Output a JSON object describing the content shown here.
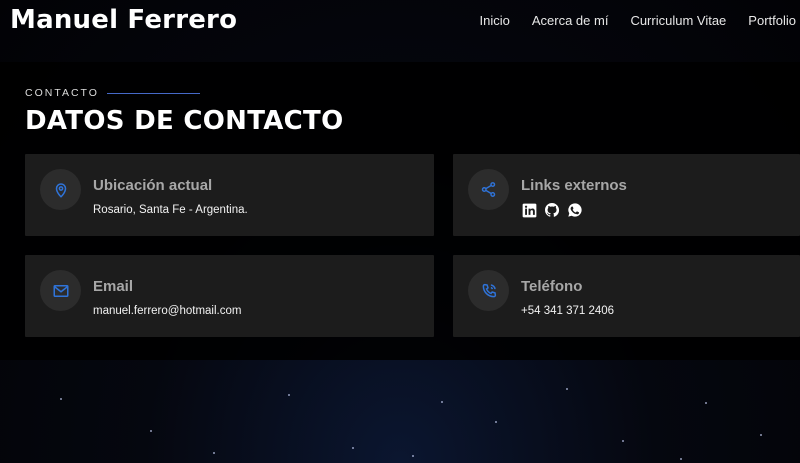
{
  "header": {
    "brand": "Manuel Ferrero",
    "nav": [
      "Inicio",
      "Acerca de mí",
      "Curriculum Vitae",
      "Portfolio"
    ]
  },
  "contact": {
    "eyebrow": "CONTACTO",
    "title": "DATOS DE CONTACTO",
    "cards": [
      {
        "title": "Ubicación actual",
        "value": "Rosario, Santa Fe - Argentina.",
        "icon": "location-pin-icon"
      },
      {
        "title": "Links externos",
        "icon": "share-icon",
        "links": [
          "linkedin-icon",
          "github-icon",
          "whatsapp-icon"
        ]
      },
      {
        "title": "Email",
        "value": "manuel.ferrero@hotmail.com",
        "icon": "mail-icon"
      },
      {
        "title": "Teléfono",
        "value": "+54 341 371 2406",
        "icon": "phone-icon"
      }
    ]
  },
  "colors": {
    "accent": "#2f73d8",
    "card_bg": "#1c1c1c",
    "icon_bg": "#2c2c2c"
  }
}
